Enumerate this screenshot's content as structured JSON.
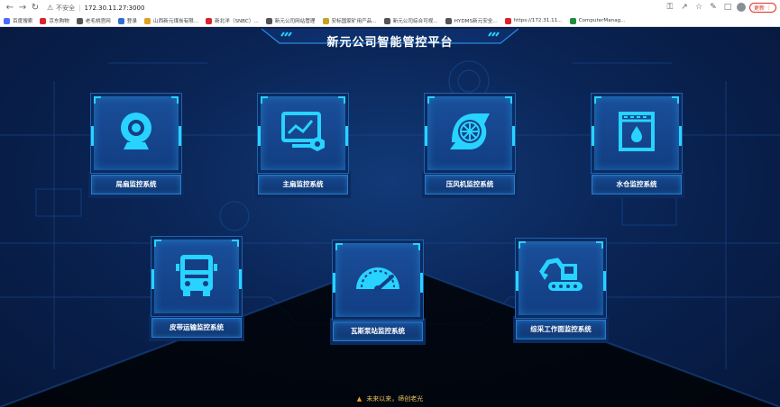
{
  "browser": {
    "address": {
      "security_label": "不安全",
      "url": "172.30.11.27:3000"
    },
    "update_label": "更新",
    "bookmarks": [
      {
        "label": "百度搜索",
        "color": "#4a6cf7"
      },
      {
        "label": "京东购物",
        "color": "#d9232d"
      },
      {
        "label": "老毛桃官网",
        "color": "#555555"
      },
      {
        "label": "登录",
        "color": "#2f6fd6"
      },
      {
        "label": "山西新元煤炭有限...",
        "color": "#e0a020"
      },
      {
        "label": "新北洋（SNBC）...",
        "color": "#d9232d"
      },
      {
        "label": "新元公司网站管理",
        "color": "#555555"
      },
      {
        "label": "安标国家矿用产品...",
        "color": "#c8a020"
      },
      {
        "label": "新元公司综合可视...",
        "color": "#555555"
      },
      {
        "label": "HYDMS新元安全...",
        "color": "#555555"
      },
      {
        "label": "https://172.31.11...",
        "color": "#d9232d"
      },
      {
        "label": "ComputerManag...",
        "color": "#1e8e3e"
      }
    ]
  },
  "app": {
    "title": "新元公司智能管控平台",
    "footer": "未来以来，缔创老光",
    "tiles": [
      {
        "label": "局扇监控系统",
        "icon": "webcam-icon"
      },
      {
        "label": "主扇监控系统",
        "icon": "monitor-settings-icon"
      },
      {
        "label": "压风机监控系统",
        "icon": "air-compressor-icon"
      },
      {
        "label": "水仓监控系统",
        "icon": "water-tank-icon"
      },
      {
        "label": "皮带运输监控系统",
        "icon": "truck-icon"
      },
      {
        "label": "瓦斯泵站监控系统",
        "icon": "gauge-icon"
      },
      {
        "label": "综采工作面监控系统",
        "icon": "excavator-icon"
      }
    ],
    "colors": {
      "accent": "#28d3ff",
      "background": "#0a2455",
      "tile": "#1a4f9a"
    }
  }
}
